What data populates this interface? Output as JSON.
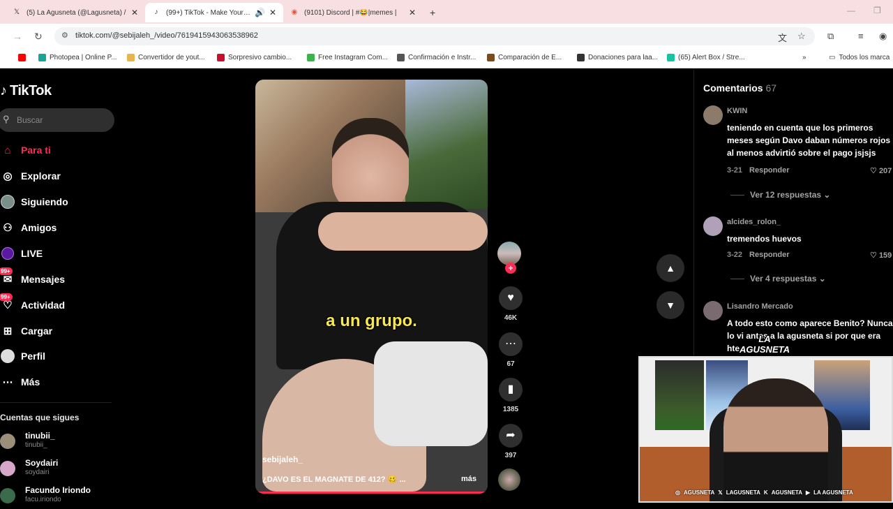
{
  "browser": {
    "tabs": [
      {
        "icon": "x-icon",
        "title": "(5) La Agusneta (@Lagusneta) /",
        "active": false
      },
      {
        "icon": "tiktok-icon",
        "title": "(99+) TikTok - Make Your Da",
        "active": true,
        "audio": "🔊"
      },
      {
        "icon": "discord-icon",
        "title": "(9101) Discord | #😂|memes |",
        "active": false
      }
    ],
    "new_tab": "+",
    "minimize": "—",
    "restore": "❐",
    "url": "tiktok.com/@sebijaleh_/video/7619415943063538962",
    "bookmarks": [
      {
        "label": "",
        "color": "#ff0000"
      },
      {
        "label": "Photopea | Online P...",
        "color": "#18a497"
      },
      {
        "label": "Convertidor de yout...",
        "color": "#e8b54a"
      },
      {
        "label": "Sorpresivo cambio...",
        "color": "#c8102e"
      },
      {
        "label": "Free Instagram Com...",
        "color": "#3bb54a"
      },
      {
        "label": "Confirmación e Instr...",
        "color": "#555555"
      },
      {
        "label": "Comparación de E...",
        "color": "#7a4b1c"
      },
      {
        "label": "Donaciones para laa...",
        "color": "#333333"
      },
      {
        "label": "(65) Alert Box / Stre...",
        "color": "#17c3a3"
      }
    ],
    "bookmarks_overflow": "»",
    "all_bookmarks": "Todos los marca"
  },
  "tiktok": {
    "logo": "TikTok",
    "search_placeholder": "Buscar",
    "nav": [
      {
        "label": "Para ti",
        "icon": "home-icon",
        "glyph": "⌂",
        "active": true
      },
      {
        "label": "Explorar",
        "icon": "compass-icon",
        "glyph": "◎",
        "active": false
      },
      {
        "label": "Siguiendo",
        "icon": "following-avatar-icon",
        "glyph": "●",
        "active": false
      },
      {
        "label": "Amigos",
        "icon": "friends-icon",
        "glyph": "⚇",
        "active": false
      },
      {
        "label": "LIVE",
        "icon": "live-icon",
        "glyph": "▣",
        "active": false
      },
      {
        "label": "Mensajes",
        "icon": "messages-icon",
        "glyph": "✉",
        "badge": "99+",
        "active": false
      },
      {
        "label": "Actividad",
        "icon": "activity-icon",
        "glyph": "♡",
        "badge": "99+",
        "active": false
      },
      {
        "label": "Cargar",
        "icon": "upload-icon",
        "glyph": "⊞",
        "active": false
      },
      {
        "label": "Perfil",
        "icon": "profile-icon",
        "glyph": "●",
        "active": false
      },
      {
        "label": "Más",
        "icon": "more-icon",
        "glyph": "⋯",
        "active": false
      }
    ],
    "following_heading": "Cuentas que sigues",
    "following": [
      {
        "name": "tinubii_",
        "user": "tinubii_",
        "color": "#9c8f7a"
      },
      {
        "name": "Soydairi",
        "user": "soydairi",
        "color": "#d6a7c9"
      },
      {
        "name": "Facundo Iriondo",
        "user": "facu.iriondo",
        "color": "#3b6b4a"
      }
    ],
    "video": {
      "subtitle": "a un grupo.",
      "author": "sebijaleh_",
      "description": "¿DAVO ES EL MAGNATE DE 412? 🥴 ...",
      "more": "más",
      "progress": 0.99
    },
    "actions": {
      "follow": "+",
      "likes": "46K",
      "comments": "67",
      "saves": "1385",
      "shares": "397"
    },
    "comments": {
      "title": "Comentarios",
      "count": "67",
      "items": [
        {
          "user": "KWIN",
          "text": "teniendo en cuenta que los primeros\nmeses según Davo daban números rojos\nal menos advirtió sobre el pago jsjsjs",
          "date": "3-21",
          "reply": "Responder",
          "likes": "207",
          "replies": "Ver 12 respuestas",
          "avatar": "#8c7b6a"
        },
        {
          "user": "alcides_rolon_",
          "text": "tremendos huevos",
          "date": "3-22",
          "reply": "Responder",
          "likes": "159",
          "replies": "Ver 4 respuestas",
          "avatar": "#b0a0b8"
        },
        {
          "user": "Lisandro Mercado",
          "text": "A todo esto como aparece Benito? Nunca\nlo vi antes a la agusneta si por que era\nhte",
          "avatar": "#7a6b70"
        }
      ]
    }
  },
  "overlay": {
    "logo_line1": "LA",
    "logo_line2": "AGUSNETA",
    "socials": [
      {
        "icon": "instagram-icon",
        "glyph": "◎",
        "label": "AGUSNETA"
      },
      {
        "icon": "x-icon",
        "glyph": "𝕏",
        "label": "LAGUSNETA"
      },
      {
        "icon": "kick-icon",
        "glyph": "K",
        "label": "AGUSNETA"
      },
      {
        "icon": "youtube-icon",
        "glyph": "▶",
        "label": "LA AGUSNETA"
      }
    ]
  }
}
